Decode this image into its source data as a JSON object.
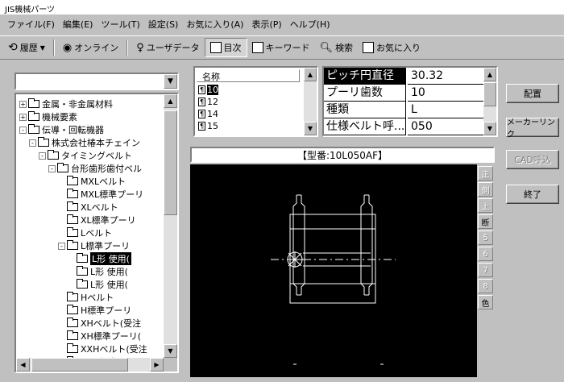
{
  "window": {
    "title": "JIS機械パーツ"
  },
  "menu": [
    "ファイル(F)",
    "編集(E)",
    "ツール(T)",
    "設定(S)",
    "お気に入り(A)",
    "表示(P)",
    "ヘルプ(H)"
  ],
  "toolbar": {
    "history": "履歴",
    "online": "オンライン",
    "userdata": "ユーザデータ",
    "contents": "目次",
    "keyword": "キーワード",
    "search": "検索",
    "favorites": "お気に入り"
  },
  "tree": {
    "items": [
      {
        "label": "金属・非金属材料",
        "level": 0,
        "exp": "+"
      },
      {
        "label": "機械要素",
        "level": 0,
        "exp": "+"
      },
      {
        "label": "伝導・回転機器",
        "level": 0,
        "exp": "-"
      },
      {
        "label": "株式会社椿本チェイン",
        "level": 1,
        "exp": "-"
      },
      {
        "label": "タイミングベルト",
        "level": 2,
        "exp": "-"
      },
      {
        "label": "台形歯形歯付ベル",
        "level": 3,
        "exp": "-"
      },
      {
        "label": "MXLベルト",
        "level": 4,
        "exp": ""
      },
      {
        "label": "MXL標準プーリ",
        "level": 4,
        "exp": ""
      },
      {
        "label": "XLベルト",
        "level": 4,
        "exp": ""
      },
      {
        "label": "XL標準プーリ",
        "level": 4,
        "exp": ""
      },
      {
        "label": "Lベルト",
        "level": 4,
        "exp": ""
      },
      {
        "label": "L標準プーリ",
        "level": 4,
        "exp": "-"
      },
      {
        "label": "L形 使用(",
        "level": 5,
        "exp": "",
        "selected": true
      },
      {
        "label": "L形 使用(",
        "level": 5,
        "exp": ""
      },
      {
        "label": "L形 使用(",
        "level": 5,
        "exp": ""
      },
      {
        "label": "Hベルト",
        "level": 4,
        "exp": ""
      },
      {
        "label": "H標準プーリ",
        "level": 4,
        "exp": ""
      },
      {
        "label": "XHベルト(受注",
        "level": 4,
        "exp": ""
      },
      {
        "label": "XH標準プーリ(",
        "level": 4,
        "exp": ""
      },
      {
        "label": "XXHベルト(受注",
        "level": 4,
        "exp": ""
      },
      {
        "label": "XXH標準プーリ",
        "level": 4,
        "exp": ""
      }
    ]
  },
  "namelist": {
    "header": "名称",
    "rows": [
      "10",
      "12",
      "14",
      "15"
    ],
    "selected_index": 0
  },
  "props": [
    {
      "key": "ピッチ円直径",
      "value": "30.32",
      "highlight": true
    },
    {
      "key": "プーリ歯数",
      "value": "10"
    },
    {
      "key": "種類",
      "value": "L"
    },
    {
      "key": "仕様ベルト呼...",
      "value": "050"
    }
  ],
  "buttons": {
    "place": "配置",
    "maker_link": "メーカーリンク",
    "cad_call": "CAD呼込",
    "exit": "終了"
  },
  "model": {
    "label": "【型番:10L050AF】"
  },
  "view_buttons": [
    "正",
    "側",
    "上",
    "断",
    "5",
    "6",
    "7",
    "8",
    "色"
  ],
  "view_active": [
    3,
    8
  ],
  "colors": {
    "canvas_bg": "#000000",
    "drawing_line": "#ffffff",
    "panel": "#c0c0c0"
  }
}
